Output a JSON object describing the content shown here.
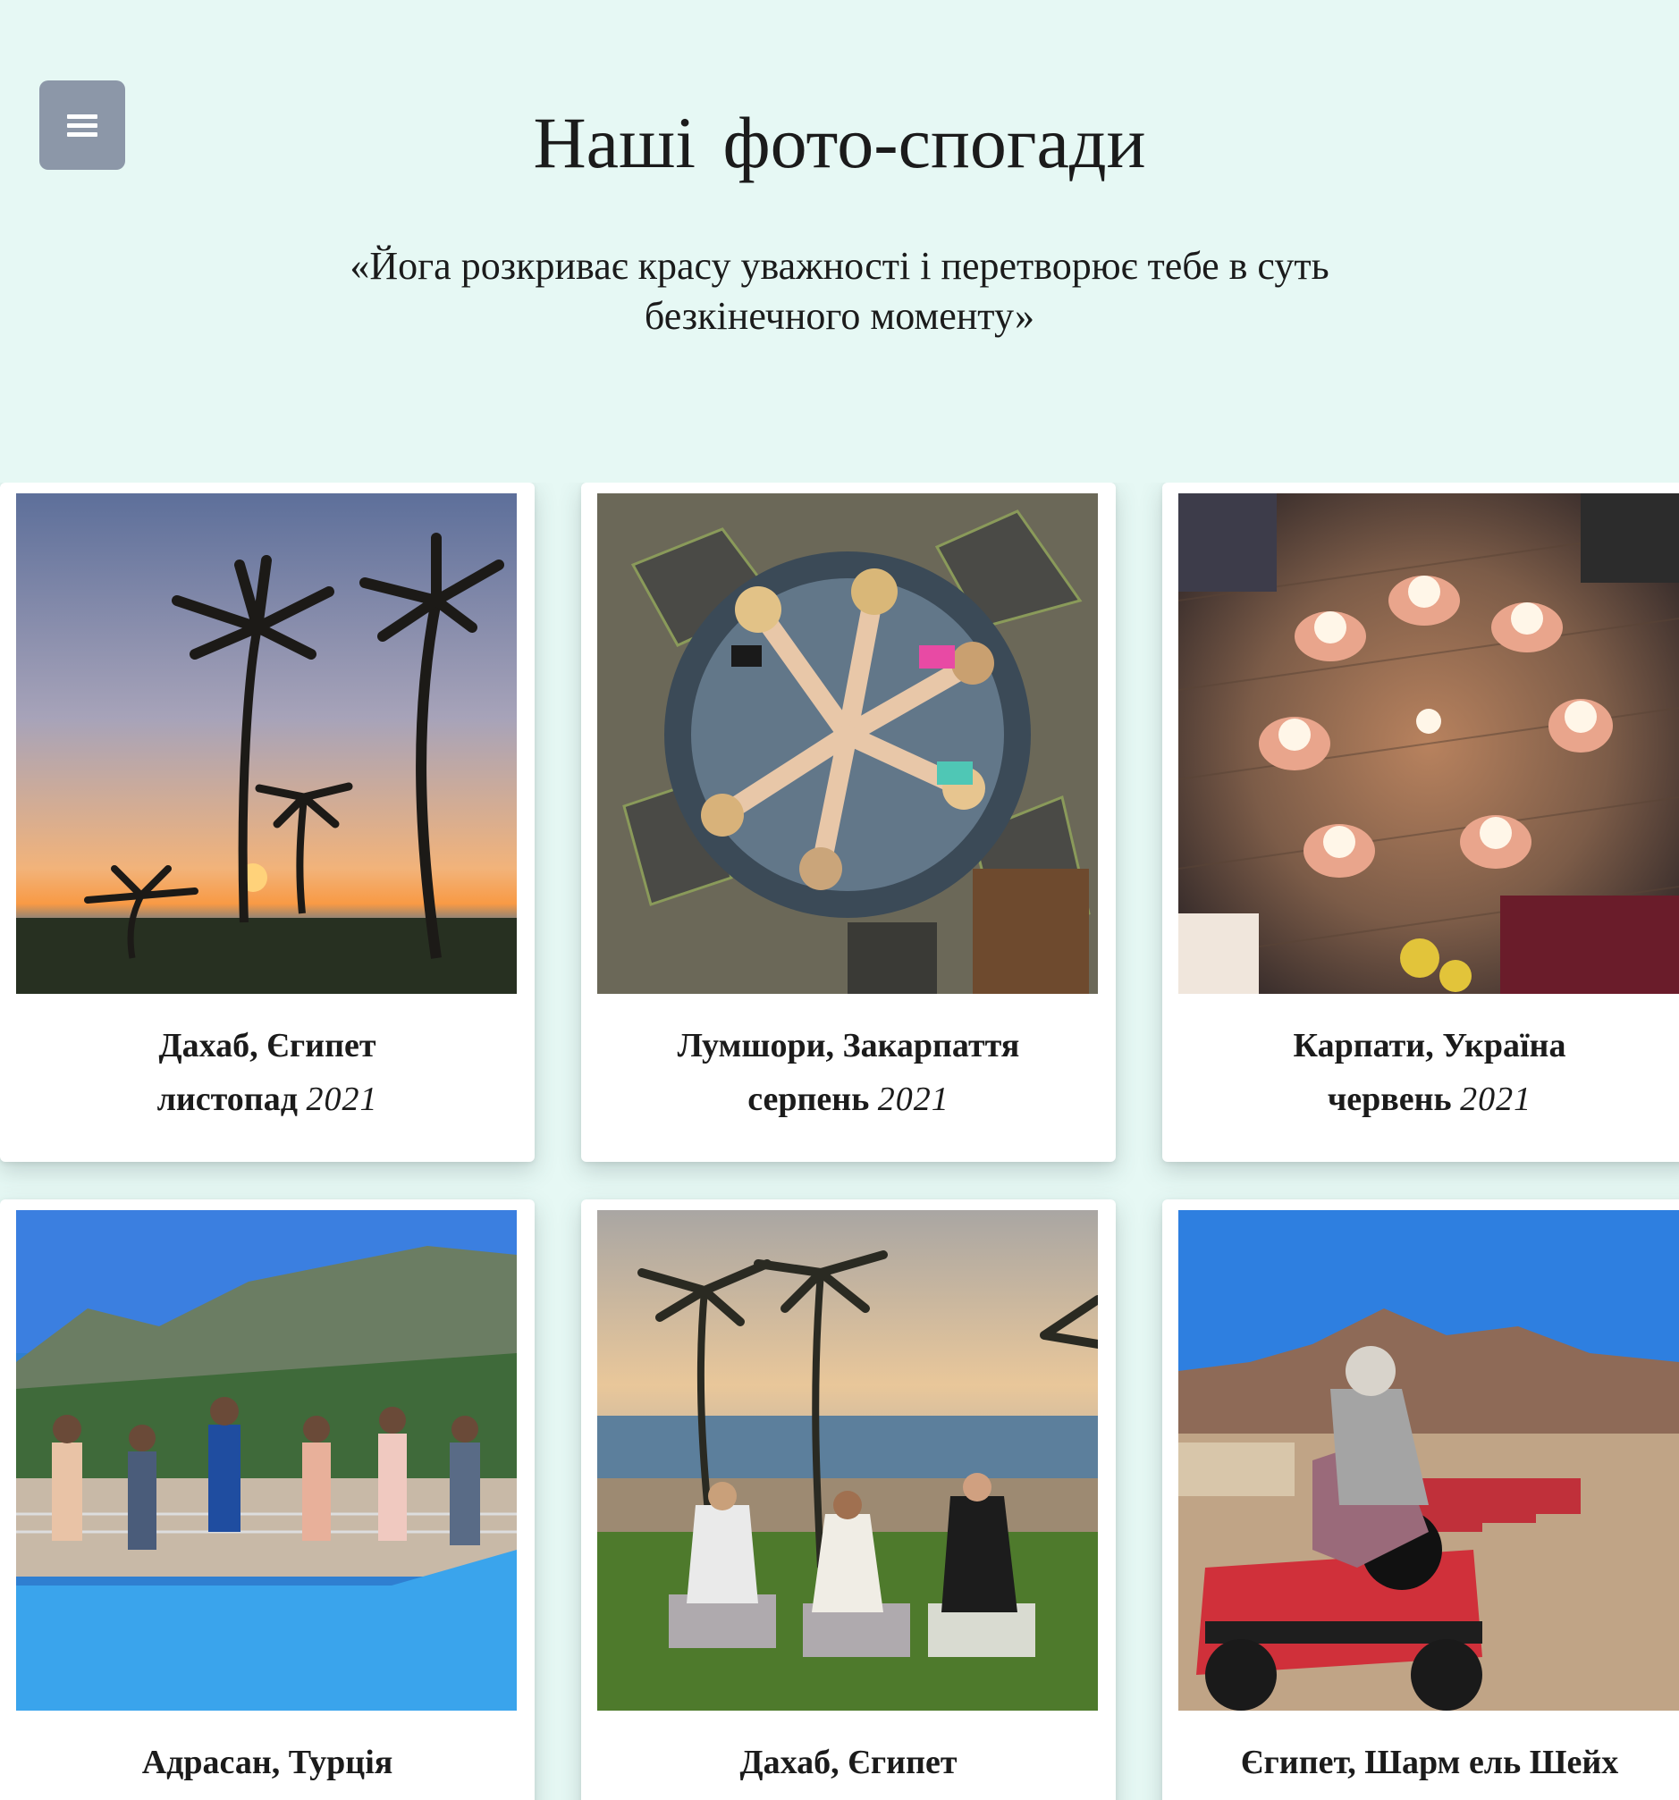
{
  "header": {
    "menu_icon": "hamburger-menu-icon",
    "title": "Наші  фото-спогади",
    "quote": "«Йога розкриває красу уважності і перетворює тебе в суть безкінечного моменту»"
  },
  "gallery": {
    "cards": [
      {
        "place": "Дахаб, Єгипет",
        "month": "листопад",
        "year": "2021",
        "image": "palm-trees-sunset-photo"
      },
      {
        "place": "Лумшори, Закарпаття",
        "month": "серпень",
        "year": "2021",
        "image": "group-in-hot-tub-photo"
      },
      {
        "place": "Карпати, Україна",
        "month": "червень",
        "year": "2021",
        "image": "candles-circle-hands-photo"
      },
      {
        "place": "Адрасан, Турція",
        "month": "",
        "year": "",
        "image": "yoga-by-pool-photo"
      },
      {
        "place": "Дахаб, Єгипет",
        "month": "",
        "year": "",
        "image": "beach-meditation-photo"
      },
      {
        "place": "Єгипет, Шарм ель Шейх",
        "month": "",
        "year": "",
        "image": "quad-bike-desert-photo"
      }
    ]
  },
  "colors": {
    "background": "#e6f8f4",
    "menu_button": "#8c97a8",
    "card": "#ffffff"
  }
}
